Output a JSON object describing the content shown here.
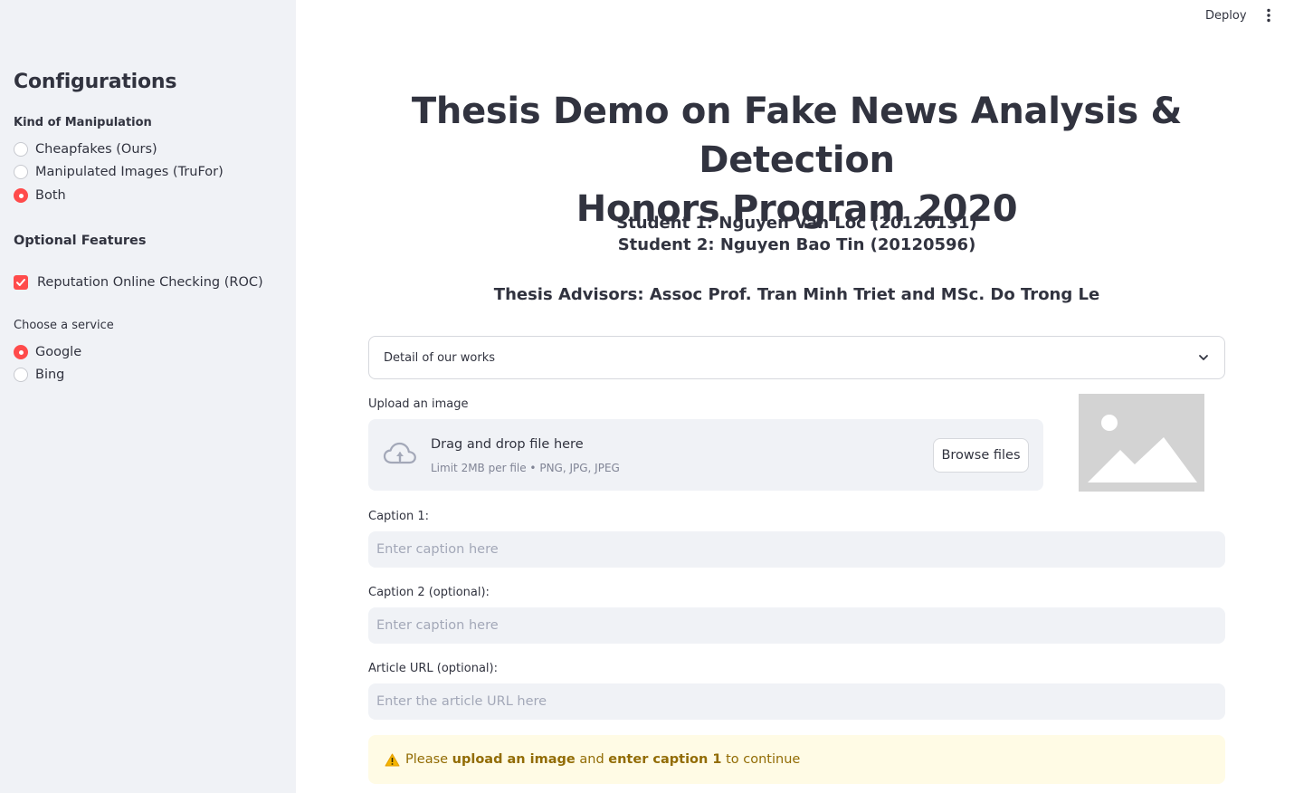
{
  "sidebar": {
    "title": "Configurations",
    "manipulation": {
      "label": "Kind of Manipulation",
      "options": [
        "Cheapfakes (Ours)",
        "Manipulated Images (TruFor)",
        "Both"
      ],
      "selected": "Both"
    },
    "optional_features": {
      "heading": "Optional Features",
      "roc_label": "Reputation Online Checking (ROC)",
      "roc_checked": true
    },
    "service": {
      "label": "Choose a service",
      "options": [
        "Google",
        "Bing"
      ],
      "selected": "Google"
    }
  },
  "header": {
    "deploy_label": "Deploy",
    "menu_icon": "kebab-menu-icon"
  },
  "main": {
    "title_line1": "Thesis Demo on Fake News Analysis & Detection",
    "title_line2": "Honors Program 2020",
    "student1": "Student 1: Nguyen Van Loc (20120131)",
    "student2": "Student 2: Nguyen Bao Tin (20120596)",
    "advisors": "Thesis Advisors: Assoc Prof. Tran Minh Triet and MSc. Do Trong Le",
    "expander_label": "Detail of our works",
    "upload": {
      "label": "Upload an image",
      "drag_text": "Drag and drop file here",
      "limit_text": "Limit 2MB per file • PNG, JPG, JPEG",
      "browse_label": "Browse files",
      "icon": "cloud-upload-icon"
    },
    "caption1": {
      "label": "Caption 1:",
      "placeholder": "Enter caption here",
      "value": ""
    },
    "caption2": {
      "label": "Caption 2 (optional):",
      "placeholder": "Enter caption here",
      "value": ""
    },
    "article_url": {
      "label": "Article URL (optional):",
      "placeholder": "Enter the article URL here",
      "value": ""
    },
    "warning": {
      "icon": "warning-icon",
      "prefix": "Please ",
      "bold1": "upload an image",
      "middle": " and ",
      "bold2": "enter caption 1",
      "suffix": " to continue"
    }
  },
  "colors": {
    "accent": "#ff4b4b",
    "sidebar_bg": "#f0f2f6",
    "text": "#31333f",
    "warning_bg": "#fffbe5",
    "warning_text": "#926c05"
  }
}
